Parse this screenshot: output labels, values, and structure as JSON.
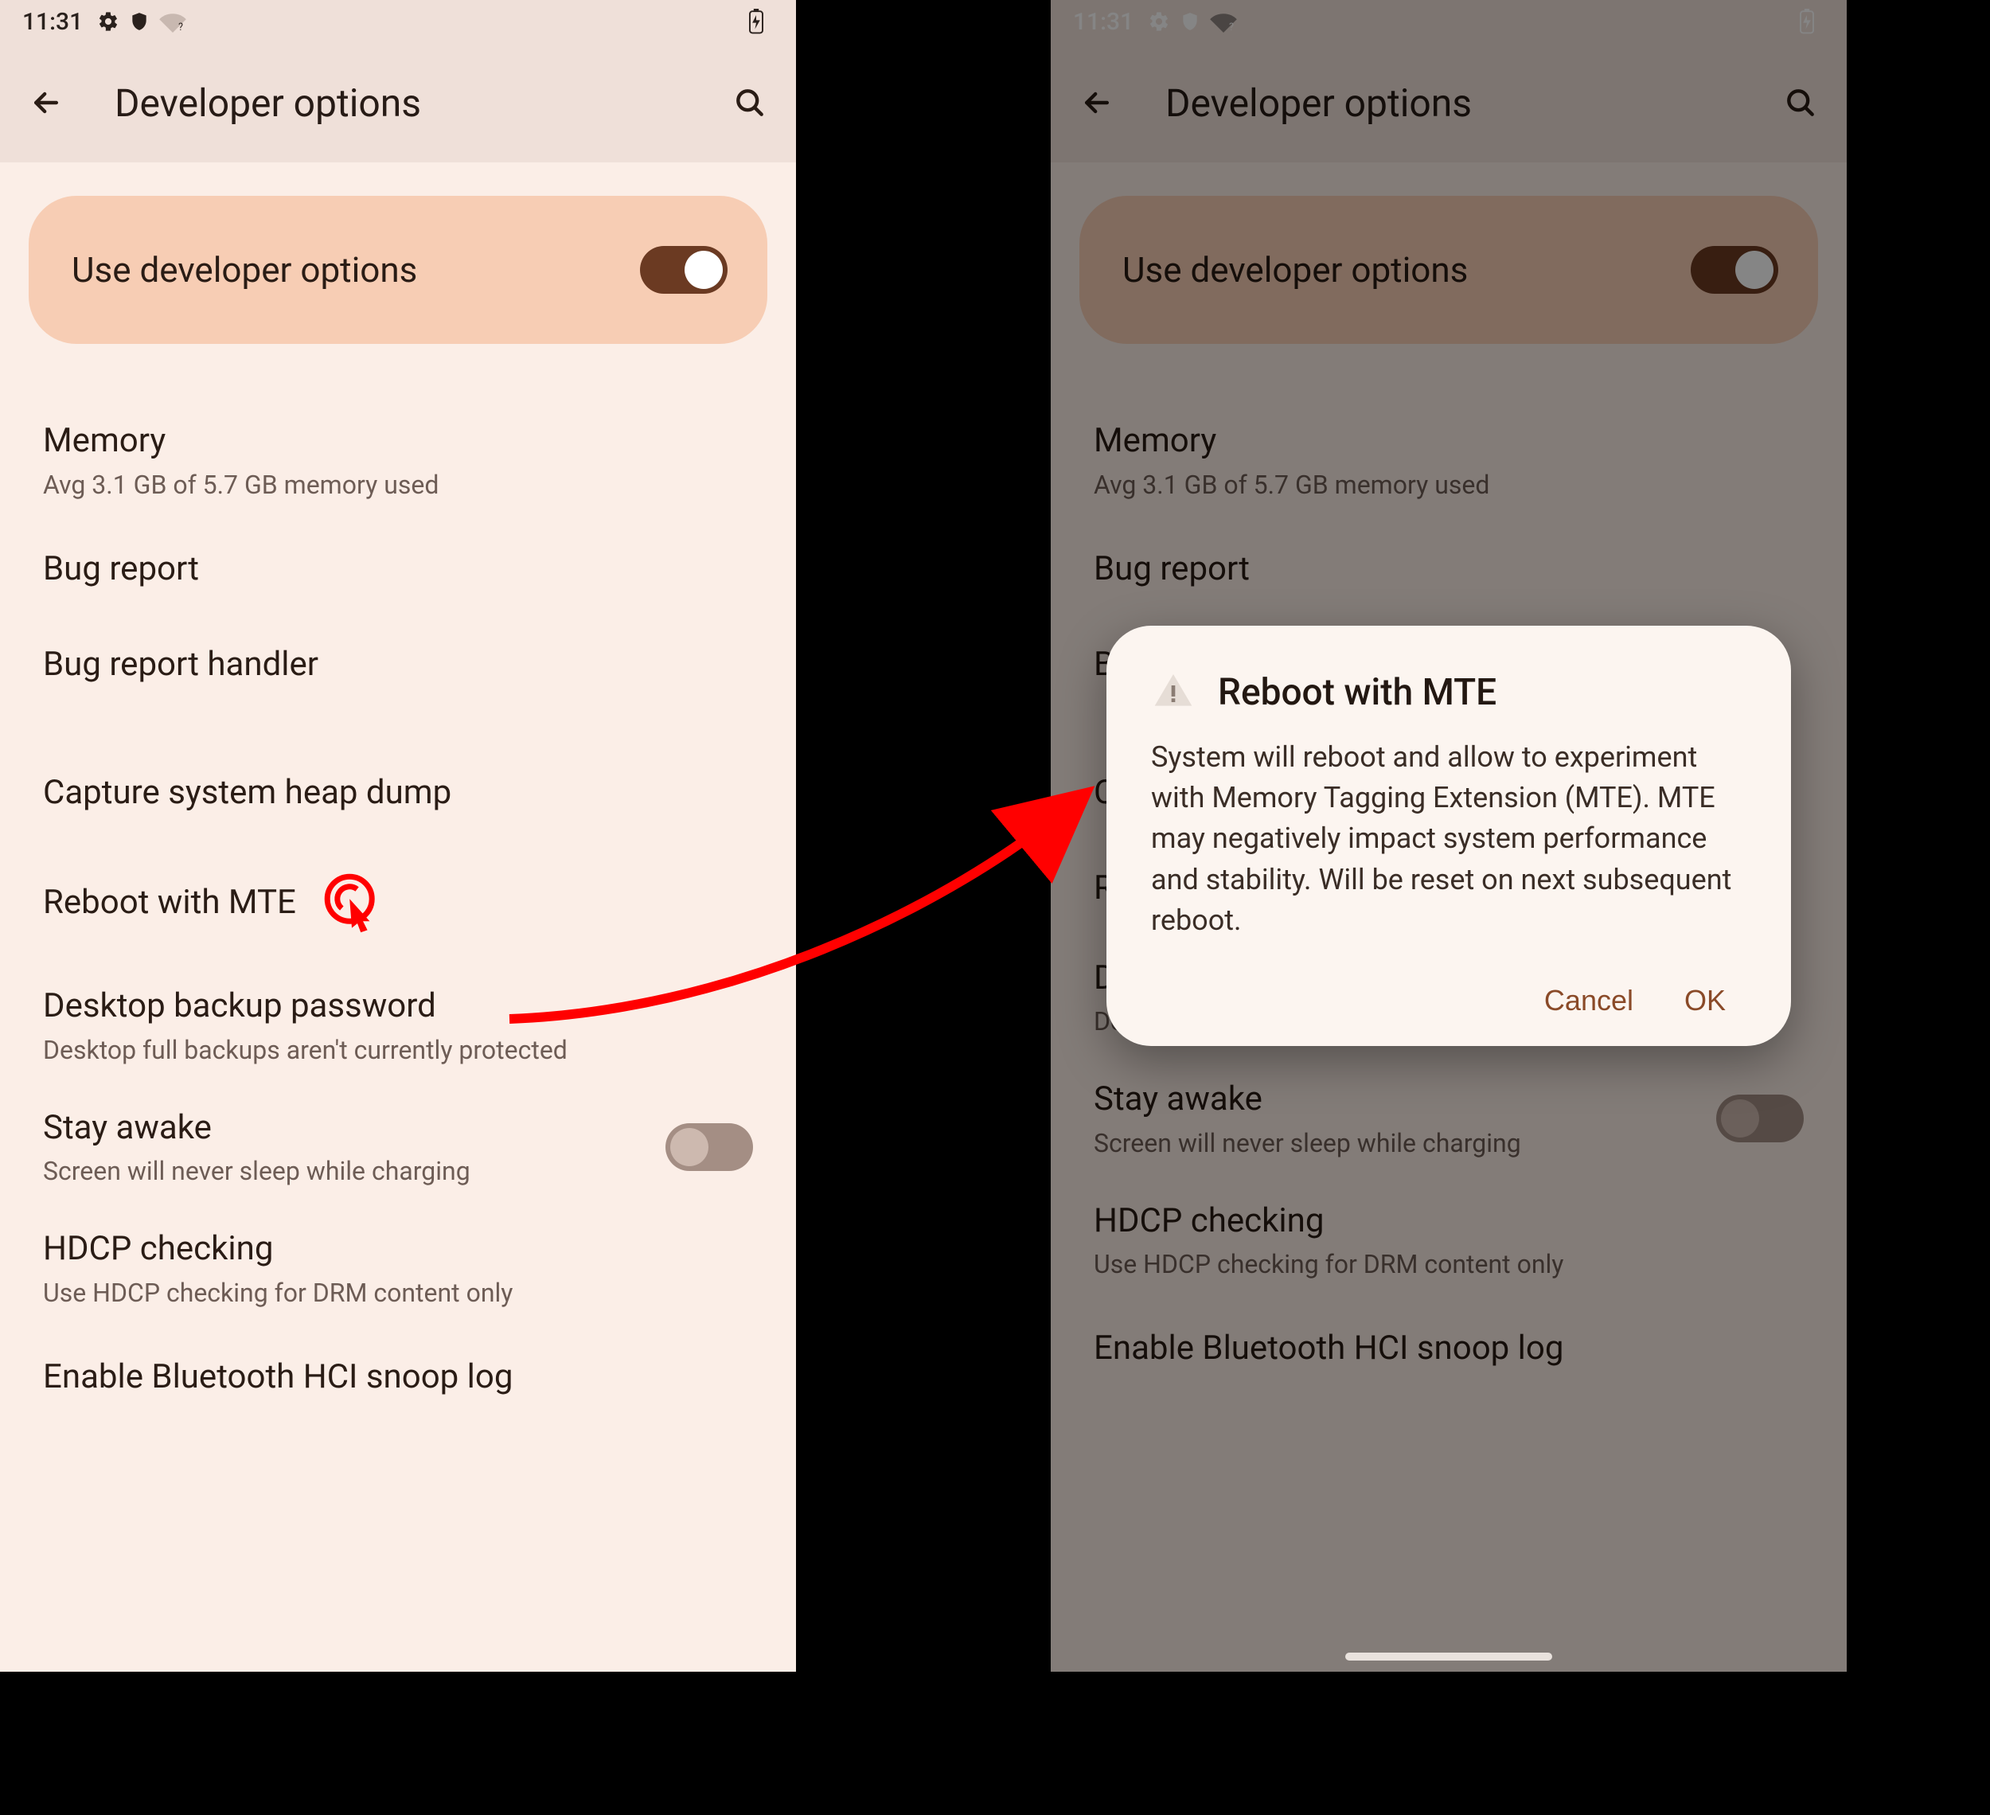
{
  "status": {
    "time": "11:31"
  },
  "appbar": {
    "title": "Developer options"
  },
  "master_toggle": {
    "label": "Use developer options",
    "on": true
  },
  "rows": {
    "memory": {
      "title": "Memory",
      "sub": "Avg 3.1 GB of 5.7 GB memory used"
    },
    "bugreport": {
      "title": "Bug report"
    },
    "bugreport_handler": {
      "title": "Bug report handler"
    },
    "heapdump": {
      "title": "Capture system heap dump"
    },
    "reboot_mte": {
      "title": "Reboot with MTE"
    },
    "backup_pw": {
      "title": "Desktop backup password",
      "sub": "Desktop full backups aren't currently protected"
    },
    "stay_awake": {
      "title": "Stay awake",
      "sub": "Screen will never sleep while charging",
      "on": false
    },
    "hdcp": {
      "title": "HDCP checking",
      "sub": "Use HDCP checking for DRM content only"
    },
    "bthci": {
      "title": "Enable Bluetooth HCI snoop log"
    }
  },
  "dialog": {
    "title": "Reboot with MTE",
    "body": "System will reboot and allow to experiment with Memory Tagging Extension (MTE). MTE may negatively impact system performance and stability. Will be reset on next subsequent reboot.",
    "cancel": "Cancel",
    "ok": "OK"
  },
  "annotation": {
    "arrow_color": "#ff0000"
  }
}
